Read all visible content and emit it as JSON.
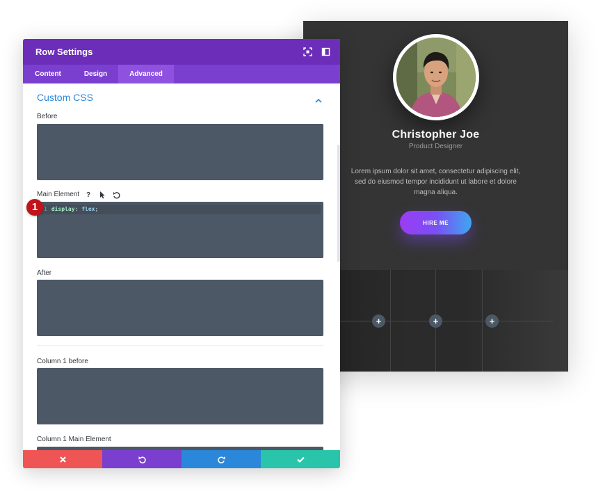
{
  "modal": {
    "title": "Row Settings",
    "tabs": [
      {
        "label": "Content",
        "active": false
      },
      {
        "label": "Design",
        "active": false
      },
      {
        "label": "Advanced",
        "active": true
      }
    ],
    "section_title": "Custom CSS",
    "fields": [
      {
        "label": "Before",
        "code": ""
      },
      {
        "label": "Main Element",
        "code_line_number": "1",
        "code_property": "display",
        "code_colon": ":",
        "code_value": "flex",
        "code_semicolon": ";"
      },
      {
        "label": "After",
        "code": ""
      },
      {
        "label": "Column 1 before",
        "code": ""
      },
      {
        "label": "Column 1 Main Element",
        "code": ""
      }
    ],
    "field_icons": [
      "help-icon",
      "pointer-icon",
      "reset-icon"
    ],
    "footer": [
      {
        "icon": "close-icon",
        "color": "#ef5555"
      },
      {
        "icon": "undo-icon",
        "color": "#7b3fd0"
      },
      {
        "icon": "redo-icon",
        "color": "#2b87da"
      },
      {
        "icon": "check-icon",
        "color": "#29c4a9"
      }
    ],
    "header_color": "#6c2eb9",
    "tabs_color": "#7b3fd0"
  },
  "annotation": {
    "badge": "1"
  },
  "preview": {
    "name": "Christopher Joe",
    "role": "Product Designer",
    "bio": "Lorem ipsum dolor sit amet, consectetur adipiscing elit, sed do eiusmod tempor incididunt ut labore et dolore magna aliqua.",
    "button_label": "HIRE ME",
    "add_buttons": [
      "+",
      "+",
      "+"
    ]
  }
}
